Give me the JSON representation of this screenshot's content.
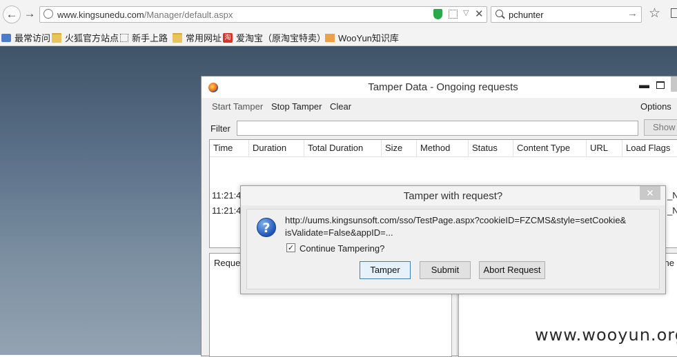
{
  "browser": {
    "url_host": "www.kingsunedu.com",
    "url_path": "/Manager/default.aspx",
    "search_query": "pchunter"
  },
  "bookmarks": [
    {
      "label": "最常访问",
      "icon": "visit-icon"
    },
    {
      "label": "火狐官方站点",
      "icon": "folder-icon"
    },
    {
      "label": "新手上路",
      "icon": "dotted-page-icon"
    },
    {
      "label": "常用网址",
      "icon": "folder-icon"
    },
    {
      "label": "爱淘宝（原淘宝特卖）",
      "icon": "taobao-icon"
    },
    {
      "label": "WooYun知识库",
      "icon": "rss-icon"
    }
  ],
  "tamper_window": {
    "title": "Tamper Data - Ongoing requests",
    "menu": {
      "start": "Start Tamper",
      "stop": "Stop Tamper",
      "clear": "Clear",
      "options": "Options"
    },
    "filter_label": "Filter",
    "filter_value": "",
    "show_label": "Show",
    "columns": [
      "Time",
      "Duration",
      "Total Duration",
      "Size",
      "Method",
      "Status",
      "Content Type",
      "URL",
      "Load Flags"
    ],
    "rows": [
      {
        "time": "11:21:4",
        "flags": "_NE"
      },
      {
        "time": "11:21:4",
        "flags": "_NE"
      }
    ],
    "left_pane_header": "Reques",
    "right_pane_header": "ne"
  },
  "dialog": {
    "title": "Tamper with request?",
    "close_glyph": "✕",
    "message_line1": "http://uums.kingsunsoft.com/sso/TestPage.aspx?cookieID=FZCMS&style=setCookie&",
    "message_line2": "isValidate=False&appID=...",
    "checkbox_label": "Continue Tampering?",
    "checkbox_checked": true,
    "buttons": {
      "tamper": "Tamper",
      "submit": "Submit",
      "abort": "Abort Request"
    }
  },
  "watermark": "www.wooyun.org"
}
